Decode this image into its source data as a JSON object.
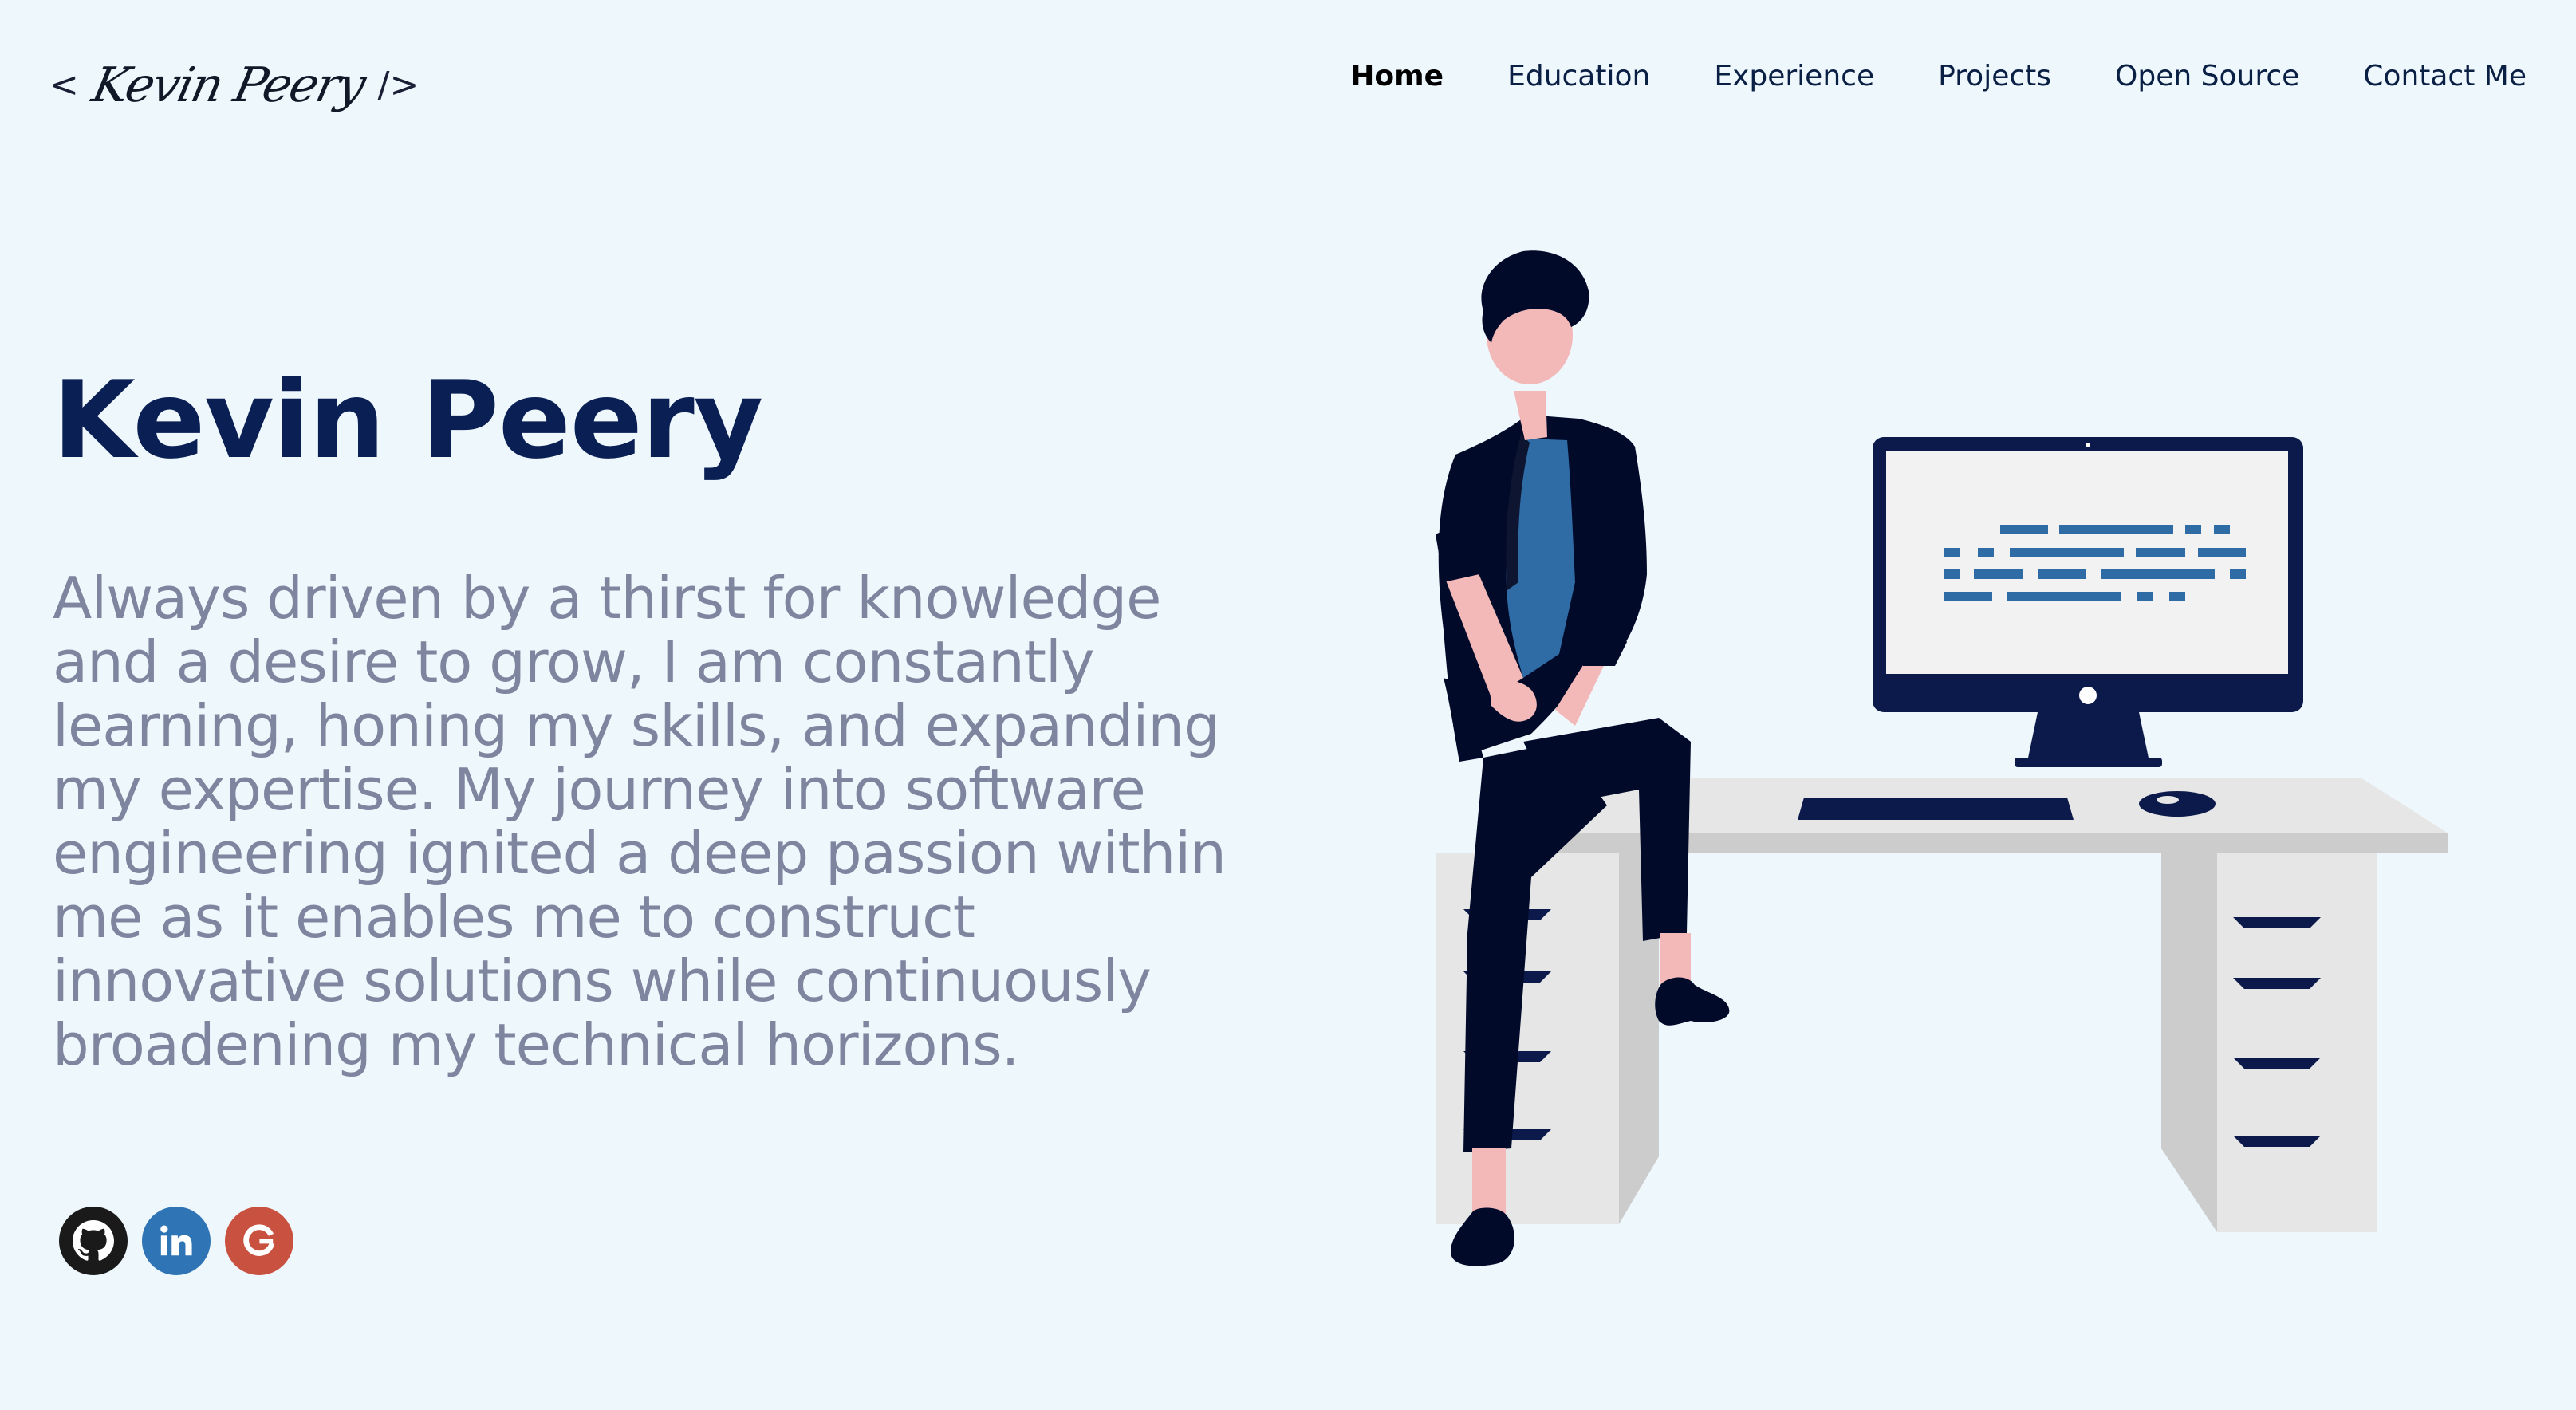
{
  "header": {
    "logo": {
      "open_bracket": "<",
      "signature": "Kevin Peery",
      "close_bracket": "/>"
    },
    "nav": [
      {
        "label": "Home",
        "active": true
      },
      {
        "label": "Education",
        "active": false
      },
      {
        "label": "Experience",
        "active": false
      },
      {
        "label": "Projects",
        "active": false
      },
      {
        "label": "Open Source",
        "active": false
      },
      {
        "label": "Contact Me",
        "active": false
      }
    ]
  },
  "hero": {
    "title": "Kevin Peery",
    "description": "Always driven by a thirst for knowledge and a desire to grow, I am constantly learning, honing my skills, and expanding my expertise. My journey into software engineering ignited a deep passion within me as it enables me to construct innovative solutions while continuously broadening my technical horizons."
  },
  "socials": [
    {
      "icon": "github-icon",
      "color": "#1a1a1a"
    },
    {
      "icon": "linkedin-icon",
      "color": "#2f75b5"
    },
    {
      "icon": "google-icon",
      "color": "#c9513f"
    }
  ],
  "colors": {
    "background": "#eef7fc",
    "title": "#0a1f54",
    "description": "#7e869f",
    "nav_text": "#0a1f44",
    "illustration_navy": "#0b1a4a",
    "illustration_blue": "#2f6ca6",
    "desk_light": "#e6e6e6",
    "desk_shadow": "#cccccc",
    "skin": "#f3b8b8"
  }
}
